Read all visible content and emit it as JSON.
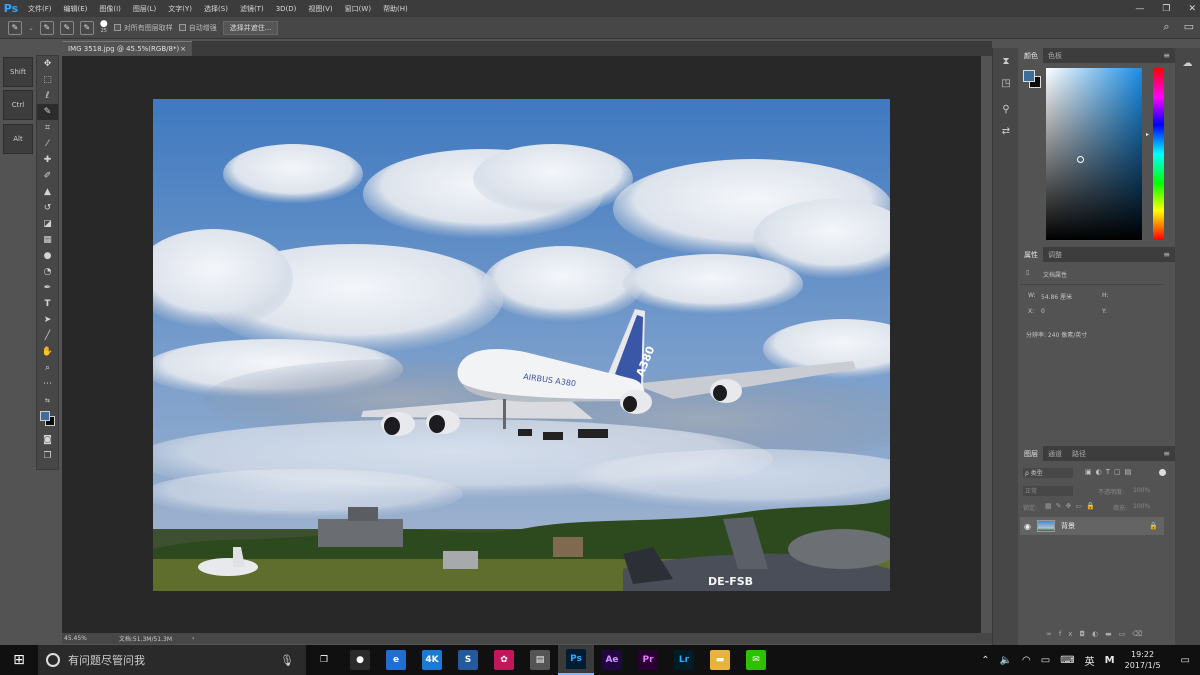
{
  "menubar": {
    "logo": "Ps",
    "items": [
      "文件(F)",
      "编辑(E)",
      "图像(I)",
      "图层(L)",
      "文字(Y)",
      "选择(S)",
      "滤镜(T)",
      "3D(D)",
      "视图(V)",
      "窗口(W)",
      "帮助(H)"
    ],
    "window_controls": [
      "—",
      "❐",
      "✕"
    ]
  },
  "options": {
    "brush_size": "25",
    "sample_all_layers": "对所有图层取样",
    "auto_enhance": "自动增强",
    "select_and_mask": "选择并遮住..."
  },
  "modifier_keys": [
    "Shift",
    "Ctrl",
    "Alt"
  ],
  "document": {
    "tab_title": "IMG 3518.jpg @ 45.5%(RGB/8*)",
    "tab_close": "×",
    "zoom": "45.45%",
    "doc_size": "文档:51.3M/51.3M",
    "status_arrow": "›"
  },
  "photo": {
    "fin_text": "A380",
    "fuselage_text": "AIRBUS A380",
    "tail_reg": "DE-FSB",
    "colors": {
      "sky_top": "#3f79c0",
      "sky_bottom": "#a7b7cf",
      "cloud": "#eef1f6",
      "grass": "#5f6e2c",
      "trees": "#2d4a1e"
    }
  },
  "color_panel": {
    "tabs": [
      "颜色",
      "色板"
    ],
    "foreground": "#3d6d99",
    "background": "#0b0b0b"
  },
  "properties_panel": {
    "tabs": [
      "属性",
      "调整"
    ],
    "heading": "文档属性",
    "w_label": "W:",
    "w_value": "54.86 厘米",
    "h_label": "H:",
    "x_label": "X:",
    "x_value": "0",
    "y_label": "Y:",
    "resolution": "分辨率: 240 像素/英寸"
  },
  "layers_panel": {
    "tabs": [
      "图层",
      "通道",
      "路径"
    ],
    "filter_kind": "ρ 类型",
    "blend_mode": "正常",
    "opacity_label": "不透明度:",
    "opacity_value": "100%",
    "lock_label": "锁定:",
    "fill_label": "填充:",
    "fill_value": "100%",
    "layer_name": "背景"
  },
  "taskbar": {
    "search_placeholder": "有问题尽管问我",
    "apps": [
      {
        "name": "task-view",
        "label": "❐",
        "color": "#101010"
      },
      {
        "name": "app-generic",
        "label": "●",
        "color": "#2b2b2b"
      },
      {
        "name": "edge",
        "label": "e",
        "color": "#1e6fd1"
      },
      {
        "name": "4k-app",
        "label": "4K",
        "color": "#1a7ad6"
      },
      {
        "name": "app-blue",
        "label": "S",
        "color": "#225a9c"
      },
      {
        "name": "davinci",
        "label": "✿",
        "color": "#c2185b"
      },
      {
        "name": "app-window",
        "label": "▤",
        "color": "#555555"
      },
      {
        "name": "photoshop",
        "label": "Ps",
        "color": "#001d34"
      },
      {
        "name": "after-effects",
        "label": "Ae",
        "color": "#1f0740"
      },
      {
        "name": "premiere",
        "label": "Pr",
        "color": "#2a0034"
      },
      {
        "name": "lightroom",
        "label": "Lr",
        "color": "#001d26"
      },
      {
        "name": "file-explorer",
        "label": "▬",
        "color": "#e8b33a"
      },
      {
        "name": "wechat",
        "label": "✉",
        "color": "#2dc100"
      }
    ],
    "ime": "英",
    "ime_mode": "M",
    "time": "19:22",
    "date": "2017/1/5"
  }
}
